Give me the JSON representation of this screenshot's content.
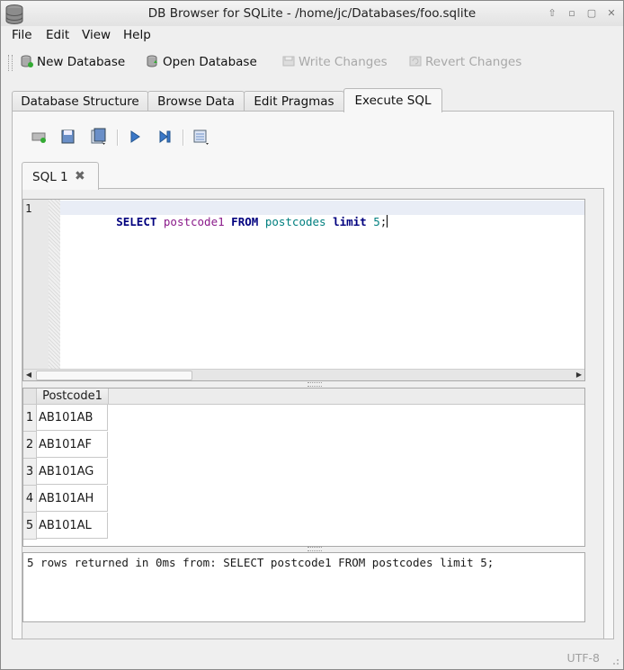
{
  "window": {
    "title": "DB Browser for SQLite - /home/jc/Databases/foo.sqlite"
  },
  "menubar": {
    "items": [
      {
        "label": "File"
      },
      {
        "label": "Edit"
      },
      {
        "label": "View"
      },
      {
        "label": "Help"
      }
    ]
  },
  "toolbar": {
    "new_database": "New Database",
    "open_database": "Open Database",
    "write_changes": "Write Changes",
    "revert_changes": "Revert Changes"
  },
  "tabs": [
    {
      "label": "Database Structure"
    },
    {
      "label": "Browse Data"
    },
    {
      "label": "Edit Pragmas"
    },
    {
      "label": "Execute SQL",
      "active": true
    }
  ],
  "sql_toolbar": {
    "icons": [
      "open-tab-icon",
      "open-sql-file-icon",
      "save-sql-file-icon",
      "execute-all-icon",
      "execute-current-line-icon",
      "export-results-icon"
    ]
  },
  "editor": {
    "tab_label": "SQL 1",
    "line_number": "1",
    "tokens": [
      {
        "text": "SELECT",
        "kind": "keyword"
      },
      {
        "text": " ",
        "kind": "space"
      },
      {
        "text": "postcode1",
        "kind": "identifier"
      },
      {
        "text": " ",
        "kind": "space"
      },
      {
        "text": "FROM",
        "kind": "keyword"
      },
      {
        "text": " ",
        "kind": "space"
      },
      {
        "text": "postcodes",
        "kind": "table"
      },
      {
        "text": " ",
        "kind": "space"
      },
      {
        "text": "limit",
        "kind": "keyword"
      },
      {
        "text": " ",
        "kind": "space"
      },
      {
        "text": "5",
        "kind": "number"
      },
      {
        "text": ";",
        "kind": "punct"
      }
    ]
  },
  "results": {
    "column_header": "Postcode1",
    "rows": [
      {
        "num": "1",
        "value": "AB101AB"
      },
      {
        "num": "2",
        "value": "AB101AF"
      },
      {
        "num": "3",
        "value": "AB101AG"
      },
      {
        "num": "4",
        "value": "AB101AH"
      },
      {
        "num": "5",
        "value": "AB101AL"
      }
    ]
  },
  "message": "5 rows returned in 0ms from: SELECT postcode1 FROM postcodes limit 5;",
  "status": {
    "encoding": "UTF-8"
  },
  "colors": {
    "keyword": "#00007f",
    "identifier": "#8a1a8a",
    "table": "#007f7f",
    "number": "#007f7f"
  }
}
